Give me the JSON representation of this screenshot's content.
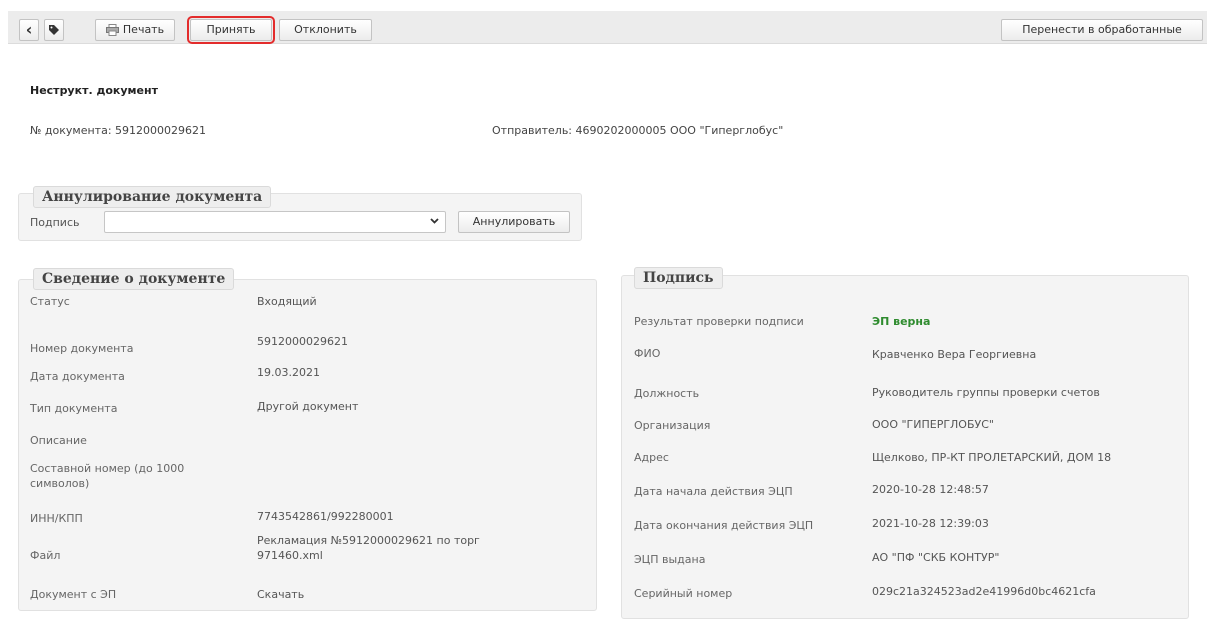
{
  "toolbar": {
    "back_label": "‹",
    "tag_label": "⬤",
    "print_label": "Печать",
    "accept_label": "Принять",
    "reject_label": "Отклонить",
    "move_label": "Перенести в обработанные"
  },
  "header": {
    "title": "Неструкт. документ",
    "doc_number": "№ документа: 5912000029621",
    "sender": "Отправитель: 4690202000005 ООО \"Гиперглобус\""
  },
  "annul": {
    "legend": "Аннулирование документа",
    "signature_label": "Подпись",
    "signature_value": "",
    "button_label": "Аннулировать"
  },
  "docinfo": {
    "legend": "Сведение о документе",
    "rows": [
      {
        "label": "Статус",
        "value": "Входящий"
      },
      {
        "label": "Номер документа",
        "value": "5912000029621"
      },
      {
        "label": "Дата документа",
        "value": "19.03.2021"
      },
      {
        "label": "Тип документа",
        "value": "Другой документ"
      },
      {
        "label": "Описание",
        "value": ""
      },
      {
        "label": "Составной номер (до 1000 символов)",
        "value": ""
      },
      {
        "label": "ИНН/КПП",
        "value": "7743542861/992280001"
      },
      {
        "label": "Файл",
        "value": "Рекламация №5912000029621 по торг 971460.xml"
      },
      {
        "label": "Документ с ЭП",
        "value": "Скачать"
      }
    ]
  },
  "signature": {
    "legend": "Подпись",
    "rows": [
      {
        "label": "Результат проверки подписи",
        "value": "ЭП верна"
      },
      {
        "label": "ФИО",
        "value": "Кравченко Вера Георгиевна"
      },
      {
        "label": "Должность",
        "value": "Руководитель группы проверки счетов"
      },
      {
        "label": "Организация",
        "value": "ООО \"ГИПЕРГЛОБУС\""
      },
      {
        "label": "Адрес",
        "value": "Щелково, ПР-КТ ПРОЛЕТАРСКИЙ, ДОМ 18"
      },
      {
        "label": "Дата начала действия ЭЦП",
        "value": "2020-10-28 12:48:57"
      },
      {
        "label": "Дата окончания действия ЭЦП",
        "value": "2021-10-28 12:39:03"
      },
      {
        "label": "ЭЦП выдана",
        "value": "АО \"ПФ \"СКБ КОНТУР\""
      },
      {
        "label": "Серийный номер",
        "value": "029c21a324523ad2e41996d0bc4621cfa"
      }
    ]
  },
  "colors": {
    "highlight": "#e32c2c",
    "valid_signature": "#2e8b2e"
  }
}
